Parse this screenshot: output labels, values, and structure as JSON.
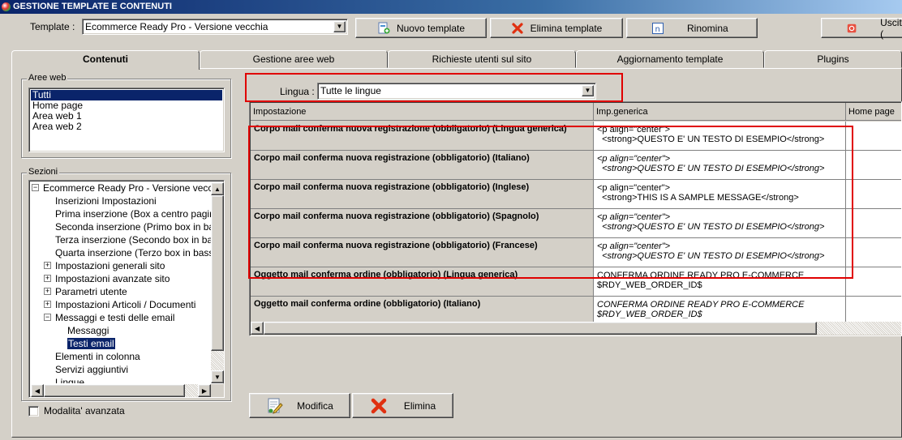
{
  "window": {
    "title": "GESTIONE TEMPLATE E CONTENUTI"
  },
  "toolbar": {
    "template_label": "Template :",
    "template_value": "Ecommerce Ready Pro - Versione vecchia",
    "new_template": "Nuovo template",
    "delete_template": "Elimina template",
    "rename": "Rinomina",
    "exit": "Uscita ("
  },
  "tabs": [
    {
      "label": "Contenuti"
    },
    {
      "label": "Gestione aree web"
    },
    {
      "label": "Richieste utenti sul sito"
    },
    {
      "label": "Aggiornamento template"
    },
    {
      "label": "Plugins"
    }
  ],
  "aree_web": {
    "title": "Aree web",
    "items": [
      "Tutti",
      "Home page",
      "Area web 1",
      "Area web 2"
    ],
    "selected": "Tutti"
  },
  "sezioni": {
    "title": "Sezioni",
    "nodes": [
      {
        "label": "Ecommerce Ready Pro - Versione vecchia",
        "expander": "−"
      },
      {
        "label": "Inserizioni Impostazioni",
        "expander": ""
      },
      {
        "label": "Prima inserzione (Box a centro pagina)",
        "expander": ""
      },
      {
        "label": "Seconda inserzione (Primo box in basso)",
        "expander": ""
      },
      {
        "label": "Terza inserzione (Secondo box in basso)",
        "expander": ""
      },
      {
        "label": "Quarta inserzione (Terzo box in basso)",
        "expander": ""
      },
      {
        "label": "Impostazioni generali sito",
        "expander": "+"
      },
      {
        "label": "Impostazioni avanzate sito",
        "expander": "+"
      },
      {
        "label": "Parametri utente",
        "expander": "+"
      },
      {
        "label": "Impostazioni Articoli / Documenti",
        "expander": "+"
      },
      {
        "label": "Messaggi e testi delle email",
        "expander": "−"
      },
      {
        "label": "Messaggi",
        "expander": ""
      },
      {
        "label": "Testi email",
        "expander": ""
      },
      {
        "label": "Elementi in colonna",
        "expander": ""
      },
      {
        "label": "Servizi aggiuntivi",
        "expander": ""
      },
      {
        "label": "Lingue",
        "expander": ""
      }
    ],
    "advanced_mode": "Modalita' avanzata"
  },
  "lingua": {
    "label": "Lingua :",
    "value": "Tutte le lingue"
  },
  "grid": {
    "columns": [
      "Impostazione",
      "Imp.generica",
      "Home page"
    ],
    "rows": [
      {
        "name": "Corpo mail conferma nuova registrazione (obbligatorio) (Lingua generica)",
        "value": "<p align=\"center\">\n  <strong>QUESTO E' UN TESTO DI ESEMPIO</strong>",
        "italic": false
      },
      {
        "name": "Corpo mail conferma nuova registrazione (obbligatorio) (Italiano)",
        "value": "<p align=\"center\">\n  <strong>QUESTO E' UN TESTO DI ESEMPIO</strong>",
        "italic": true
      },
      {
        "name": "Corpo mail conferma nuova registrazione (obbligatorio) (Inglese)",
        "value": "<p align=\"center\">\n  <strong>THIS IS A SAMPLE MESSAGE</strong>",
        "italic": false
      },
      {
        "name": "Corpo mail conferma nuova registrazione (obbligatorio) (Spagnolo)",
        "value": "<p align=\"center\">\n  <strong>QUESTO E' UN TESTO DI ESEMPIO</strong>",
        "italic": true
      },
      {
        "name": "Corpo mail conferma nuova registrazione (obbligatorio) (Francese)",
        "value": "<p align=\"center\">\n  <strong>QUESTO E' UN TESTO DI ESEMPIO</strong>",
        "italic": true
      },
      {
        "name": "Oggetto mail conferma ordine (obbligatorio) (Lingua generica)",
        "value": "CONFERMA ORDINE READY PRO E-COMMERCE\n$RDY_WEB_ORDER_ID$",
        "italic": false
      },
      {
        "name": "Oggetto mail conferma ordine (obbligatorio) (Italiano)",
        "value": "CONFERMA ORDINE READY PRO E-COMMERCE\n$RDY_WEB_ORDER_ID$",
        "italic": true
      }
    ]
  },
  "actions": {
    "modify": "Modifica",
    "delete": "Elimina"
  },
  "icons": {
    "app": "app-icon",
    "new_template": "new-template-icon",
    "delete_template": "delete-x-icon",
    "rename": "rename-icon",
    "exit": "exit-icon",
    "modify": "edit-document-icon",
    "delete": "delete-x-icon"
  },
  "colors": {
    "highlight": "#e00000",
    "selection": "#0a246a",
    "face": "#d4d0c8"
  }
}
